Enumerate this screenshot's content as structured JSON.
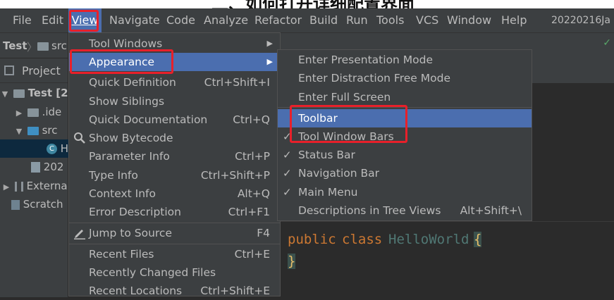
{
  "banner": {
    "title": "二、如何打开详细配置界面"
  },
  "menubar": {
    "items": [
      "File",
      "Edit",
      "View",
      "Navigate",
      "Code",
      "Analyze",
      "Refactor",
      "Build",
      "Run",
      "Tools",
      "VCS",
      "Window",
      "Help"
    ],
    "project": "20220216Ja"
  },
  "navbar": {
    "project": "Test",
    "src": "src"
  },
  "project_pane": {
    "title": "Project",
    "tree": [
      "Test [2",
      ".ide",
      "src",
      "H",
      "202",
      "Externa",
      "Scratch"
    ]
  },
  "view_menu": {
    "tool_windows": "Tool Windows",
    "appearance": "Appearance",
    "quick_definition": "Quick Definition",
    "quick_definition_sc": "Ctrl+Shift+I",
    "show_siblings": "Show Siblings",
    "quick_documentation": "Quick Documentation",
    "quick_documentation_sc": "Ctrl+Q",
    "show_bytecode": "Show Bytecode",
    "parameter_info": "Parameter Info",
    "parameter_info_sc": "Ctrl+P",
    "type_info": "Type Info",
    "type_info_sc": "Ctrl+Shift+P",
    "context_info": "Context Info",
    "context_info_sc": "Alt+Q",
    "error_description": "Error Description",
    "error_description_sc": "Ctrl+F1",
    "jump_to_source": "Jump to Source",
    "jump_to_source_sc": "F4",
    "recent_files": "Recent Files",
    "recent_files_sc": "Ctrl+E",
    "recently_changed_files": "Recently Changed Files",
    "recent_locations": "Recent Locations",
    "recent_locations_sc": "Ctrl+Shift+E"
  },
  "appearance_menu": {
    "presentation": "Enter Presentation Mode",
    "distraction_free": "Enter Distraction Free Mode",
    "full_screen": "Enter Full Screen",
    "toolbar": "Toolbar",
    "tool_window_bars": "Tool Window Bars",
    "status_bar": "Status Bar",
    "navigation_bar": "Navigation Bar",
    "main_menu": "Main Menu",
    "descriptions_tree": "Descriptions in Tree Views",
    "descriptions_tree_sc": "Alt+Shift+\\",
    "check_mark": "✓"
  },
  "editor": {
    "kw_public": "public",
    "kw_class": "class",
    "class_name": "HelloWorld",
    "open_brace": "{",
    "close_brace": "}"
  },
  "colors": {
    "menu_bg": "#3c3f41",
    "highlight": "#4b6eaf",
    "annotation_red": "#e8202a",
    "keyword": "#cc7832",
    "class_name": "#507874",
    "brace": "#e8bf6a"
  }
}
